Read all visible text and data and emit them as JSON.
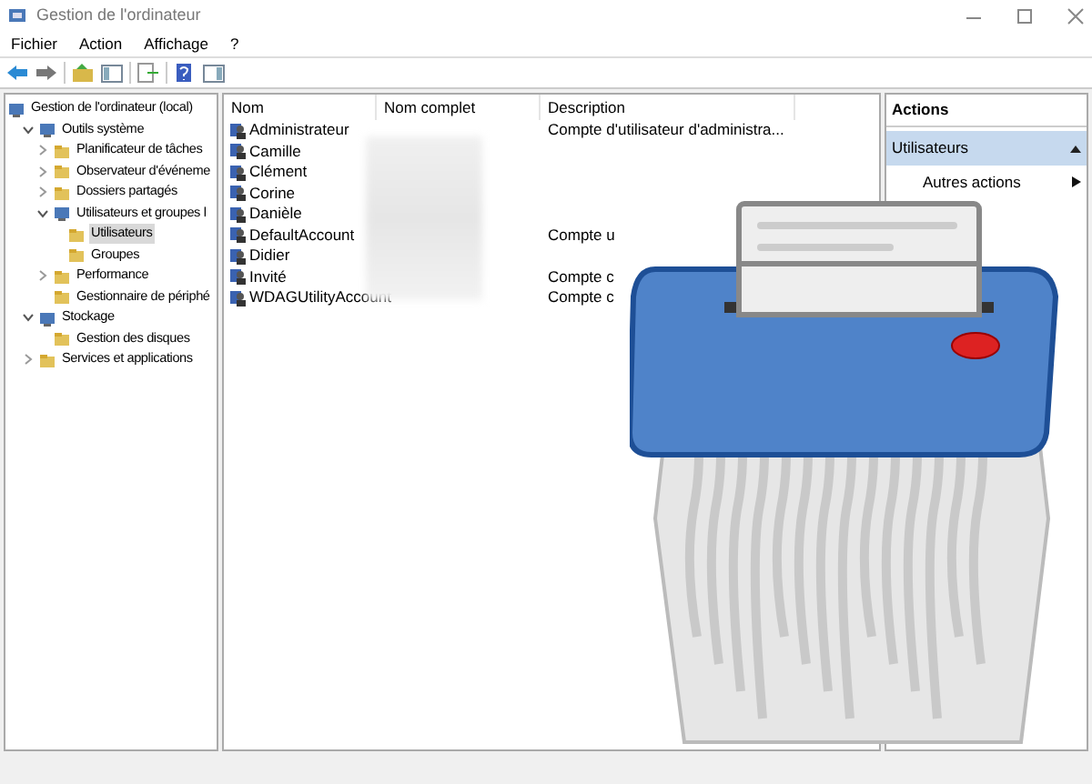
{
  "window": {
    "title": "Gestion de l'ordinateur"
  },
  "menu": [
    "Fichier",
    "Action",
    "Affichage",
    "?"
  ],
  "tree": [
    {
      "label": "Gestion de l'ordinateur (local)",
      "selected": false,
      "children": [
        {
          "label": "Outils système",
          "selected": false,
          "expanded": true,
          "children": [
            {
              "label": "Planificateur de tâches",
              "selected": false,
              "expanded": false
            },
            {
              "label": "Observateur d'événeme",
              "selected": false,
              "expanded": false
            },
            {
              "label": "Dossiers partagés",
              "selected": false,
              "expanded": false
            },
            {
              "label": "Utilisateurs et groupes l",
              "selected": false,
              "expanded": true,
              "children": [
                {
                  "label": "Utilisateurs",
                  "selected": true
                },
                {
                  "label": "Groupes",
                  "selected": false
                }
              ]
            },
            {
              "label": "Performance",
              "selected": false,
              "expanded": false
            },
            {
              "label": "Gestionnaire de périphé",
              "selected": false
            }
          ]
        },
        {
          "label": "Stockage",
          "selected": false,
          "expanded": true,
          "children": [
            {
              "label": "Gestion des disques",
              "selected": false
            }
          ]
        },
        {
          "label": "Services et applications",
          "selected": false,
          "expanded": false
        }
      ]
    }
  ],
  "table": {
    "columns": [
      "Nom",
      "Nom complet",
      "Description"
    ],
    "rows": [
      {
        "name": "Administrateur",
        "description": "Compte d'utilisateur d'administra..."
      },
      {
        "name": "Camille"
      },
      {
        "name": "Clément"
      },
      {
        "name": "Corine"
      },
      {
        "name": "Danièle"
      },
      {
        "name": "DefaultAccount",
        "description": "Compte u"
      },
      {
        "name": "Didier"
      },
      {
        "name": "Invité",
        "description": "Compte c"
      },
      {
        "name": "WDAGUtilityAccount",
        "description": "Compte c"
      }
    ]
  },
  "actions": {
    "title": "Actions",
    "section": "Utilisateurs",
    "items": [
      "Autres actions"
    ]
  }
}
